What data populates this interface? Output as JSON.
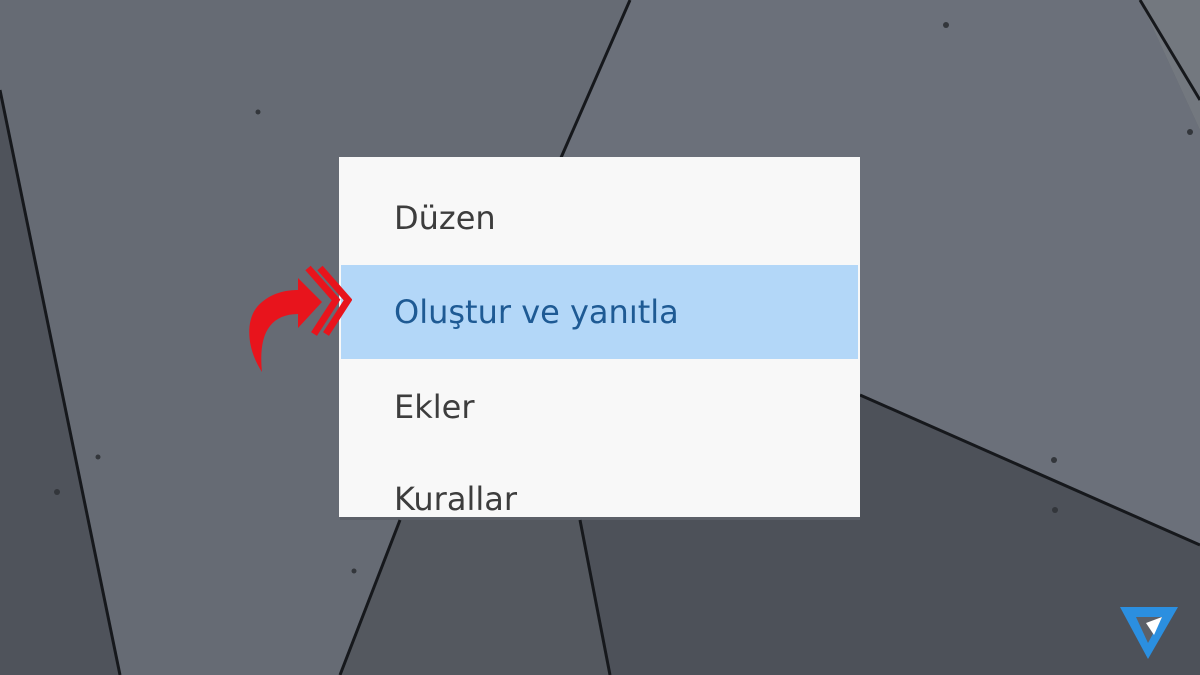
{
  "menu": {
    "items": [
      {
        "label": "Düzen",
        "selected": false
      },
      {
        "label": "Oluştur ve yanıtla",
        "selected": true
      },
      {
        "label": "Ekler",
        "selected": false
      },
      {
        "label": "Kurallar",
        "selected": false
      }
    ]
  },
  "icons": {
    "pointer": "curved-arrow-double-chevron-icon",
    "brand": "brand-logo-triangle-icon"
  },
  "colors": {
    "background": "#5c6068",
    "menu_background": "#f8f8f8",
    "selected_background": "#b3d7f8",
    "selected_text": "#1e5a94",
    "item_text": "#3d3d3d",
    "arrow": "#e8141c",
    "logo": "#2b8fe0"
  }
}
